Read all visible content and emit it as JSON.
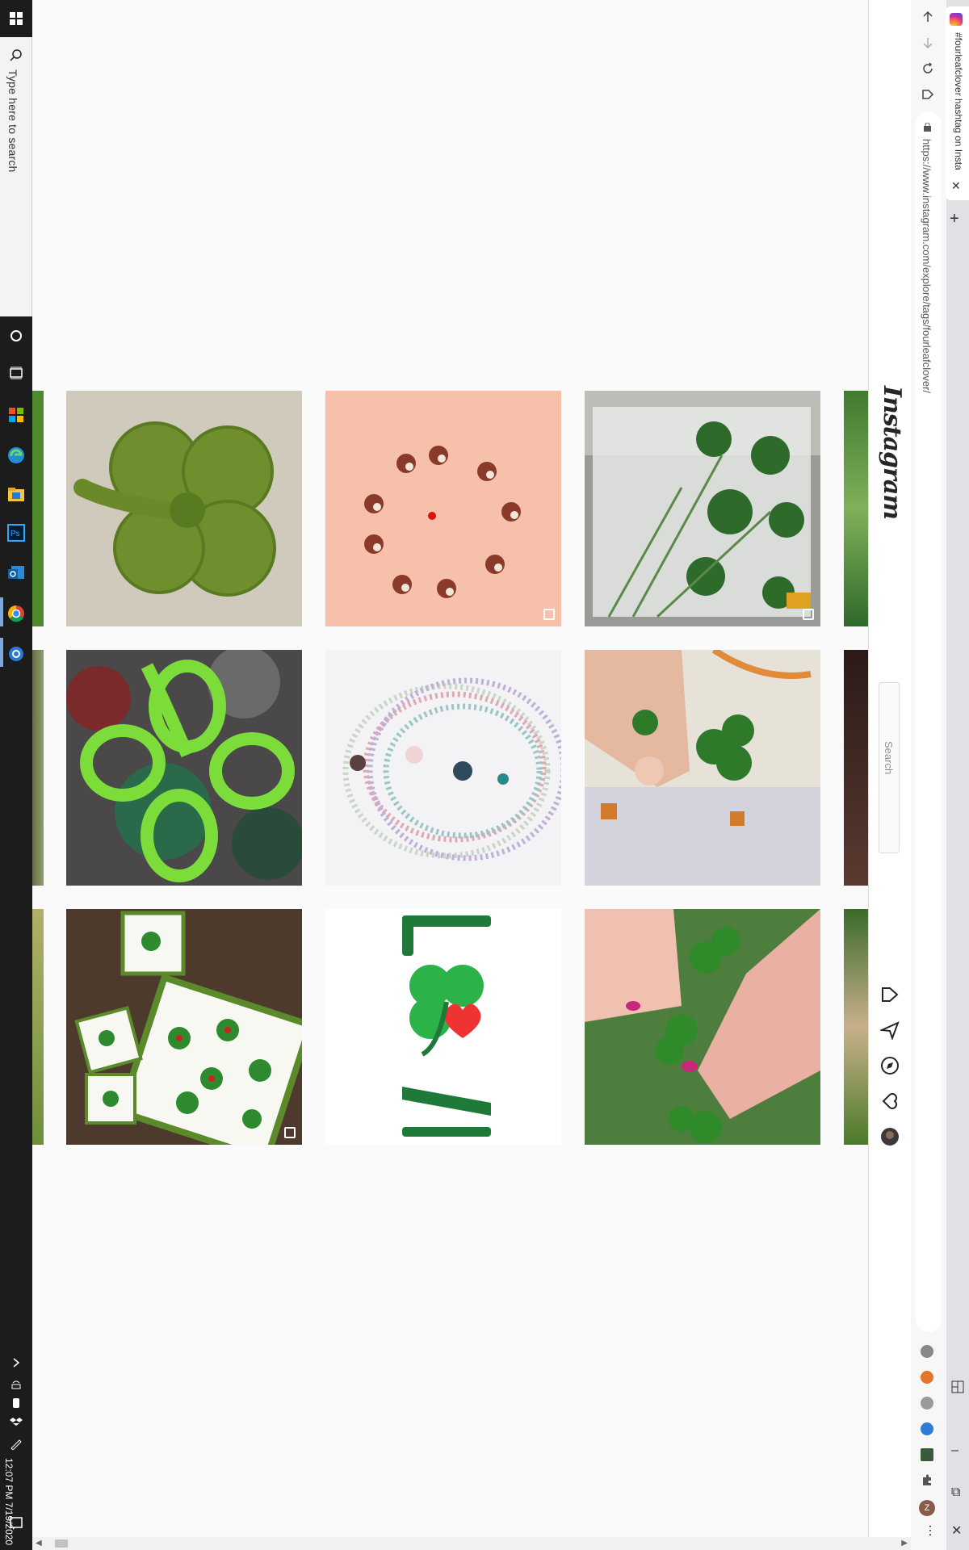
{
  "taskbar": {
    "search_placeholder": "Type here to search",
    "clock_time": "12:07 PM",
    "clock_date": "7/19/2020",
    "pinned": [
      "task-view-icon",
      "store-icon",
      "edge-icon",
      "file-explorer-icon",
      "photoshop-icon",
      "outlook-icon",
      "chrome-icon",
      "settings-icon"
    ]
  },
  "browser": {
    "tab_title": "#fourleafclover hashtag on Insta",
    "url": "https://www.instagram.com/explore/tags/fourleafclover/",
    "extensions": [
      "grammarly-icon",
      "extension-orange-icon",
      "extension-gray-icon",
      "extension-blue-icon",
      "extension-photo-icon",
      "puzzle-icon",
      "profile-icon"
    ],
    "profile_initial": "Z"
  },
  "instagram": {
    "logo": "Instagram",
    "search_placeholder": "Search",
    "nav": [
      "home-icon",
      "direct-icon",
      "explore-icon",
      "activity-icon",
      "profile-avatar"
    ]
  },
  "posts": [
    {
      "name": "post-crochet-clover",
      "multi": false
    },
    {
      "name": "post-clover-earrings",
      "multi": true
    },
    {
      "name": "post-clover-in-glass",
      "multi": true
    },
    {
      "name": "post-painted-clover",
      "multi": false
    },
    {
      "name": "post-beaded-necklaces",
      "multi": false
    },
    {
      "name": "post-hand-holding-clover",
      "multi": false
    },
    {
      "name": "post-clover-tray",
      "multi": true
    },
    {
      "name": "post-love-clover",
      "multi": false
    },
    {
      "name": "post-hands-clovers",
      "multi": false
    }
  ],
  "colors": {
    "taskbar": "#1c1c1c",
    "ig_background": "#fafafa",
    "ig_border": "#dbdbdb",
    "clover_green": "#3a9a3a"
  }
}
